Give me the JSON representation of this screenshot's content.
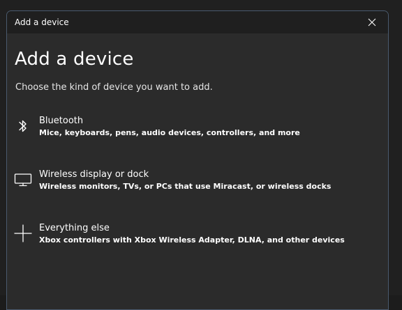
{
  "dialog": {
    "window_title": "Add a device",
    "heading": "Add a device",
    "subheading": "Choose the kind of device you want to add.",
    "options": [
      {
        "title": "Bluetooth",
        "description": "Mice, keyboards, pens, audio devices, controllers, and more",
        "icon": "bluetooth-icon"
      },
      {
        "title": "Wireless display or dock",
        "description": "Wireless monitors, TVs, or PCs that use Miracast, or wireless docks",
        "icon": "monitor-icon"
      },
      {
        "title": "Everything else",
        "description": "Xbox controllers with Xbox Wireless Adapter, DLNA, and other devices",
        "icon": "plus-icon"
      }
    ],
    "close_icon": "close-icon"
  },
  "colors": {
    "dialog_bg": "#2b2b2b",
    "titlebar_bg": "#1f1f1f",
    "border": "#4a5a6e",
    "text": "#ffffff"
  }
}
